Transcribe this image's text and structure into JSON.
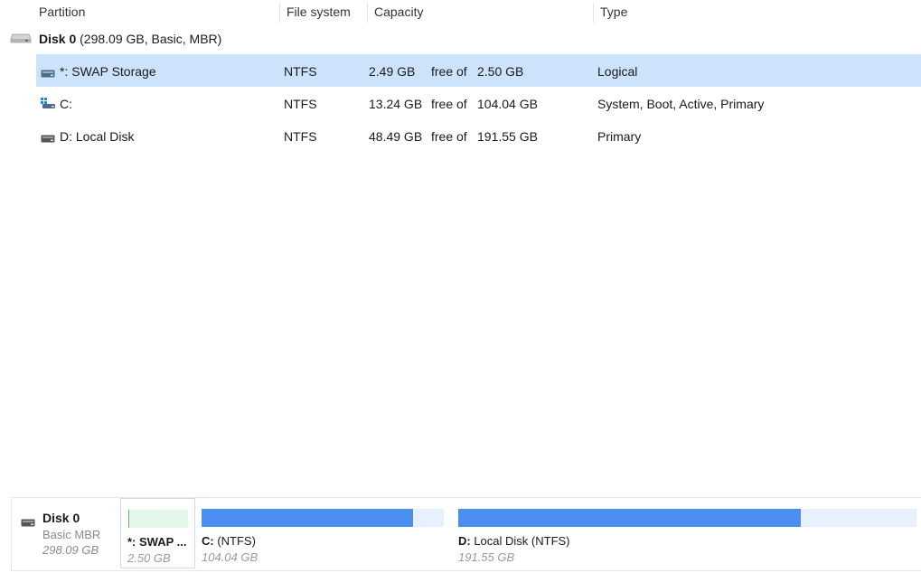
{
  "columns": {
    "partition": "Partition",
    "filesystem": "File system",
    "capacity": "Capacity",
    "type": "Type"
  },
  "disk": {
    "name": "Disk 0",
    "info": "(298.09 GB, Basic, MBR)"
  },
  "partitions": [
    {
      "name": "*: SWAP Storage",
      "fs": "NTFS",
      "free": "2.49 GB",
      "free_of": "free of",
      "total": "2.50 GB",
      "type": "Logical"
    },
    {
      "name": "C:",
      "fs": "NTFS",
      "free": "13.24 GB",
      "free_of": "free of",
      "total": "104.04 GB",
      "type": "System, Boot, Active, Primary"
    },
    {
      "name": "D: Local Disk",
      "fs": "NTFS",
      "free": "48.49 GB",
      "free_of": "free of",
      "total": "191.55 GB",
      "type": "Primary"
    }
  ],
  "map": {
    "disk_name": "Disk 0",
    "disk_type": "Basic MBR",
    "disk_size": "298.09 GB",
    "blocks": [
      {
        "label_bold": "*: SWAP ...",
        "label_rest": "",
        "size": "2.50 GB",
        "used_fraction": 0.004
      },
      {
        "label_bold": "C:",
        "label_rest": "  (NTFS)",
        "size": "104.04 GB",
        "used_fraction": 0.873
      },
      {
        "label_bold": "D:",
        "label_rest": " Local Disk (NTFS)",
        "size": "191.55 GB",
        "used_fraction": 0.747
      }
    ]
  },
  "colors": {
    "selected_row": "#cde3fb",
    "used_bar": "#4a8ff0",
    "free_bar": "#e6f1fd",
    "swap_bar": "#e4f7ea"
  },
  "icons": {
    "disk": "hard-disk-icon",
    "partition": "drive-icon",
    "system": "windows-drive-icon"
  }
}
